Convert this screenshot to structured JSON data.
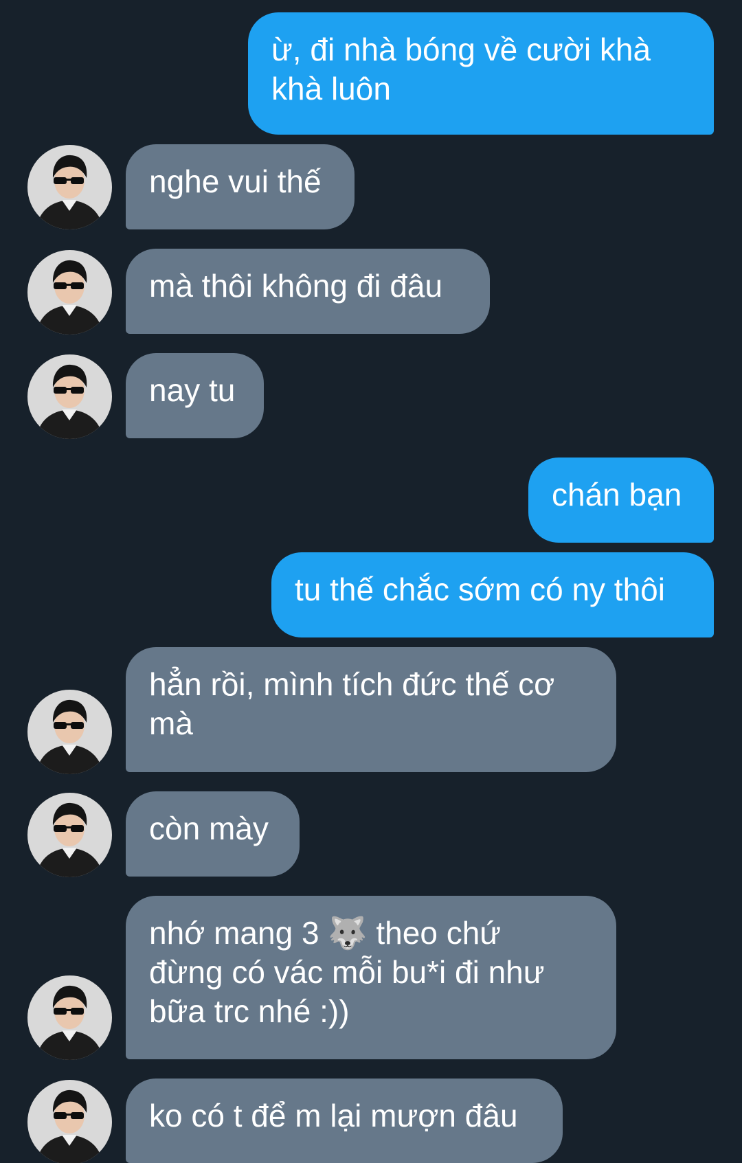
{
  "messages": [
    {
      "id": "m1",
      "direction": "outgoing",
      "text": "ừ, đi nhà bóng về cười khà\nkhà luôn"
    },
    {
      "id": "m2",
      "direction": "incoming",
      "text": "nghe vui thế"
    },
    {
      "id": "m3",
      "direction": "incoming",
      "text": "mà thôi không đi đâu"
    },
    {
      "id": "m4",
      "direction": "incoming",
      "text": "nay tu"
    },
    {
      "id": "m5",
      "direction": "outgoing",
      "text": "chán bạn"
    },
    {
      "id": "m6",
      "direction": "outgoing",
      "text": "tu thế chắc sớm có ny thôi"
    },
    {
      "id": "m7",
      "direction": "incoming",
      "text": "hẳn rồi, mình tích đức thế cơ\nmà"
    },
    {
      "id": "m8",
      "direction": "incoming",
      "text": "còn mày"
    },
    {
      "id": "m9",
      "direction": "incoming",
      "text": " nhớ mang 3 🐺 theo chứ\nđừng có vác mỗi bu*i đi như\nbữa trc nhé :))"
    },
    {
      "id": "m10",
      "direction": "incoming",
      "text": "ko có t để m lại mượn đâu"
    }
  ],
  "colors": {
    "background": "#17212b",
    "outgoing_bubble": "#1ea1f1",
    "incoming_bubble": "#66788a",
    "text": "#ffffff"
  },
  "icons": {
    "avatar": "contact-avatar-photo"
  }
}
